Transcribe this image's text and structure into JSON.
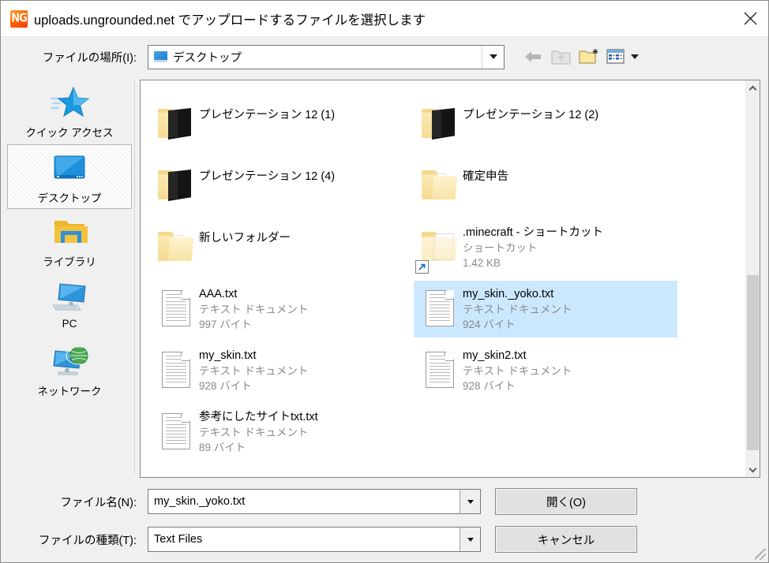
{
  "window": {
    "title": "uploads.ungrounded.net でアップロードするファイルを選択します",
    "app_icon": "ng-favicon-icon",
    "close_label": "×"
  },
  "toolbar": {
    "look_in_label": "ファイルの場所(I):",
    "current_location": "デスクトップ",
    "buttons": [
      {
        "name": "back-button",
        "icon": "back-arrow-icon",
        "enabled": true
      },
      {
        "name": "up-one-level-button",
        "icon": "up-folder-icon",
        "enabled": false
      },
      {
        "name": "create-new-folder-button",
        "icon": "new-folder-icon",
        "enabled": true
      },
      {
        "name": "view-menu-button",
        "icon": "views-list-icon",
        "enabled": true
      }
    ]
  },
  "places": {
    "items": [
      {
        "label": "クイック アクセス",
        "icon": "star-icon",
        "selected": false
      },
      {
        "label": "デスクトップ",
        "icon": "desktop-monitor-icon",
        "selected": true
      },
      {
        "label": "ライブラリ",
        "icon": "library-folder-icon",
        "selected": false
      },
      {
        "label": "PC",
        "icon": "computer-icon",
        "selected": false
      },
      {
        "label": "ネットワーク",
        "icon": "network-globe-icon",
        "selected": false
      }
    ]
  },
  "file_list": {
    "items": [
      {
        "name": "",
        "type": "",
        "size": "",
        "icon": "folder-shortcut-icon",
        "selected": false,
        "partial": true
      },
      {
        "name": "",
        "type": "",
        "size": "",
        "icon": "folder-door-icon",
        "selected": false,
        "partial": true
      },
      {
        "name": "プレゼンテーション 12 (1)",
        "type": "",
        "size": "",
        "icon": "folder-door-icon",
        "selected": false
      },
      {
        "name": "プレゼンテーション 12 (2)",
        "type": "",
        "size": "",
        "icon": "folder-door-icon",
        "selected": false
      },
      {
        "name": "プレゼンテーション 12 (4)",
        "type": "",
        "size": "",
        "icon": "folder-door-icon",
        "selected": false
      },
      {
        "name": "確定申告",
        "type": "",
        "size": "",
        "icon": "folder-icon",
        "selected": false
      },
      {
        "name": "新しいフォルダー",
        "type": "",
        "size": "",
        "icon": "folder-icon",
        "selected": false
      },
      {
        "name": ".minecraft - ショートカット",
        "type": "ショートカット",
        "size": "1.42 KB",
        "icon": "folder-shortcut-icon",
        "selected": false
      },
      {
        "name": "AAA.txt",
        "type": "テキスト ドキュメント",
        "size": "997 バイト",
        "icon": "text-document-icon",
        "selected": false
      },
      {
        "name": "my_skin._yoko.txt",
        "type": "テキスト ドキュメント",
        "size": "924 バイト",
        "icon": "text-document-icon",
        "selected": true
      },
      {
        "name": "my_skin.txt",
        "type": "テキスト ドキュメント",
        "size": "928 バイト",
        "icon": "text-document-icon",
        "selected": false
      },
      {
        "name": "my_skin2.txt",
        "type": "テキスト ドキュメント",
        "size": "928 バイト",
        "icon": "text-document-icon",
        "selected": false
      },
      {
        "name": "参考にしたサイトtxt.txt",
        "type": "テキスト ドキュメント",
        "size": "89 バイト",
        "icon": "text-document-icon",
        "selected": false
      }
    ],
    "scrollbar": {
      "up_arrow": "chevron-up-icon",
      "down_arrow": "chevron-down-icon",
      "thumb_top_pct": 49,
      "thumb_height_pct": 44
    }
  },
  "form": {
    "file_name_label": "ファイル名(N):",
    "file_name_value": "my_skin._yoko.txt",
    "file_type_label": "ファイルの種類(T):",
    "file_type_value": "Text Files",
    "open_button": "開く(O)",
    "cancel_button": "キャンセル"
  },
  "colors": {
    "selection": "#cce8ff",
    "window_bg": "#f0f0f0",
    "accent_orange": "#ff6a00"
  }
}
